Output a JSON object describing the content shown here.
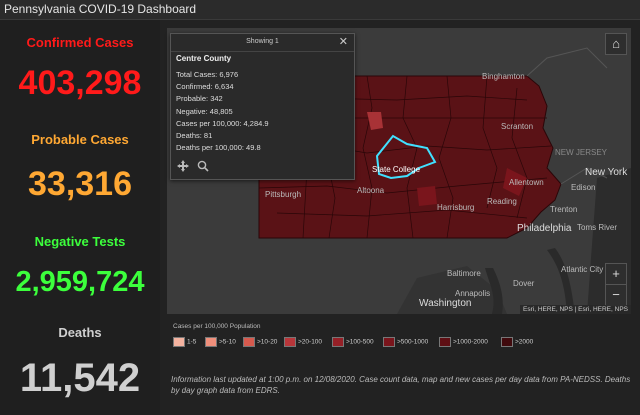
{
  "header": {
    "title": "Pennsylvania COVID-19 Dashboard"
  },
  "stats": {
    "confirmed_label": "Confirmed Cases",
    "confirmed_value": "403,298",
    "probable_label": "Probable Cases",
    "probable_value": "33,316",
    "negative_label": "Negative Tests",
    "negative_value": "2,959,724",
    "deaths_label": "Deaths",
    "deaths_value": "11,542",
    "colors": {
      "confirmed": "#ff1a1a",
      "probable": "#ffa833",
      "negative": "#3cff3c",
      "deaths": "#cfcfcf"
    }
  },
  "popup": {
    "showing": "Showing 1",
    "county": "Centre County",
    "lines": [
      "Total Cases: 6,976",
      "Confirmed: 6,634",
      "Probable: 342",
      "Negative: 48,805",
      "Cases per 100,000: 4,284.9",
      "Deaths: 81",
      "Deaths per 100,000: 49.8"
    ],
    "close_icon": "close-icon",
    "pan_icon": "move-icon",
    "zoom_icon": "zoom-to-icon"
  },
  "map": {
    "places": {
      "binghamton": "Binghamton",
      "scranton": "Scranton",
      "new_jersey": "NEW JERSEY",
      "new_york": "New York",
      "edison": "Edison",
      "allentown": "Allentown",
      "trenton": "Trenton",
      "philadelphia": "Philadelphia",
      "toms_river": "Toms River",
      "state_college": "State College",
      "altoona": "Altoona",
      "harrisburg": "Harrisburg",
      "reading": "Reading",
      "pittsburgh": "Pittsburgh",
      "baltimore": "Baltimore",
      "annapolis": "Annapolis",
      "washington": "Washington",
      "dover": "Dover",
      "atlantic_city": "Atlantic City"
    },
    "home_icon": "home-icon",
    "zoom_in": "+",
    "zoom_out": "−",
    "attribution": "Esri, HERE, NPS | Esri, HERE, NPS",
    "colors": {
      "county_fill": "#5a1216",
      "highlight": "#40e0ff",
      "background": "#3b3b3b"
    }
  },
  "legend": {
    "title": "Cases per 100,000 Population",
    "items": [
      "1-5",
      ">5-10",
      ">10-20",
      ">20-100",
      ">100-500",
      ">500-1000",
      ">1000-2000",
      ">2000"
    ],
    "colors": [
      "#f4b3a0",
      "#ef8f7b",
      "#d65a4e",
      "#b8363a",
      "#962027",
      "#7a151c",
      "#5e0f14",
      "#400a0d"
    ]
  },
  "info": {
    "text": "Information last updated at 1:00 p.m. on 12/08/2020. Case count data, map and new cases per day data from PA-NEDSS. Deaths by day graph data from EDRS."
  }
}
